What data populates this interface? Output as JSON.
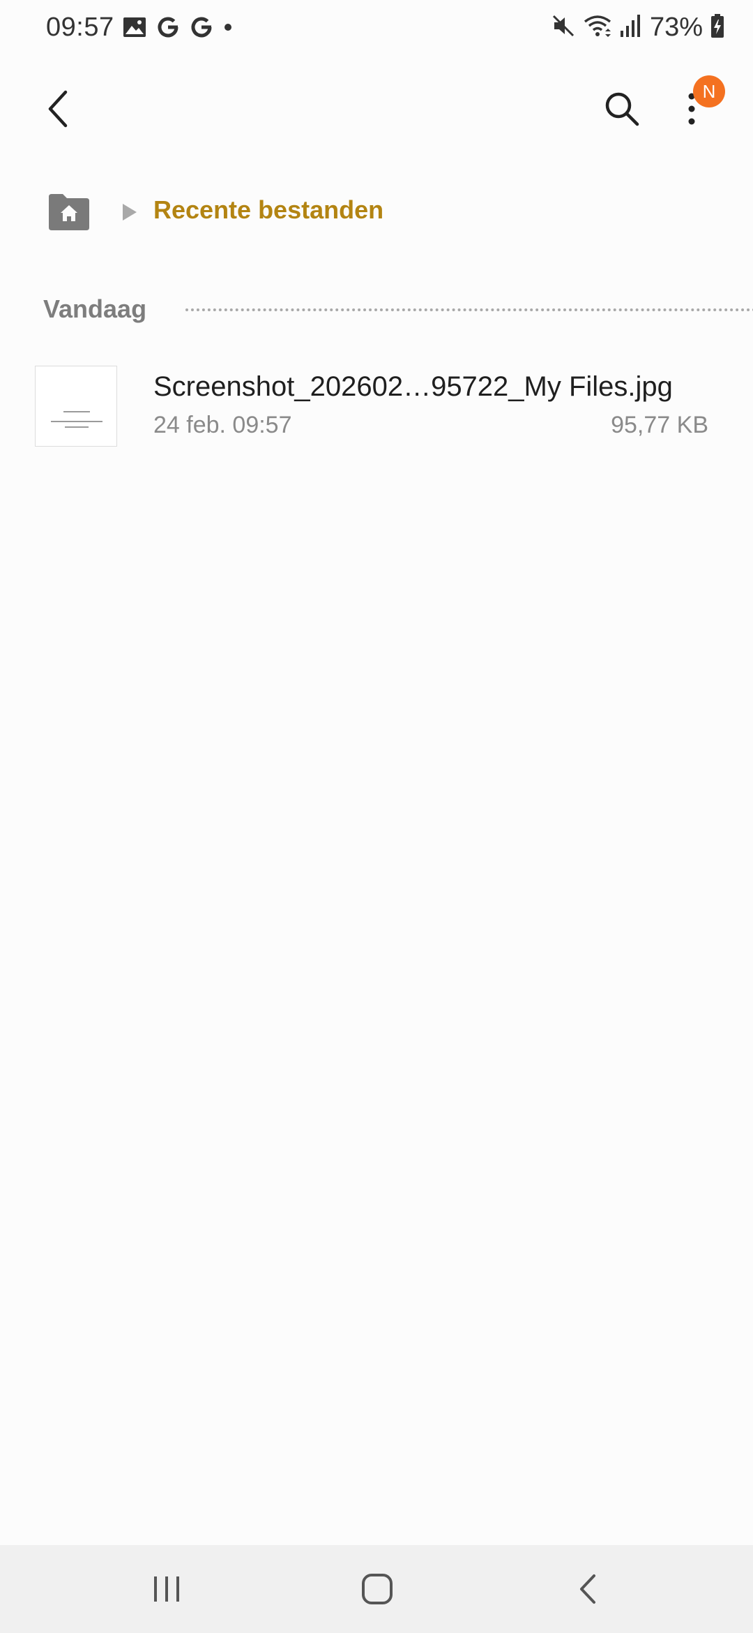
{
  "status_bar": {
    "time": "09:57",
    "battery": "73%",
    "left_icons": [
      "gallery-icon",
      "google-icon",
      "google-icon",
      "dot-icon"
    ],
    "right_icons": [
      "mute-icon",
      "wifi-icon",
      "signal-icon",
      "battery-icon"
    ]
  },
  "app_bar": {
    "notification_badge": "N",
    "badge_color": "#f47120"
  },
  "breadcrumb": {
    "current": "Recente bestanden",
    "accent_color": "#b38412"
  },
  "section": {
    "title": "Vandaag"
  },
  "files": [
    {
      "name": "Screenshot_202602…95722_My Files.jpg",
      "date": "24 feb. 09:57",
      "size": "95,77 KB"
    }
  ]
}
